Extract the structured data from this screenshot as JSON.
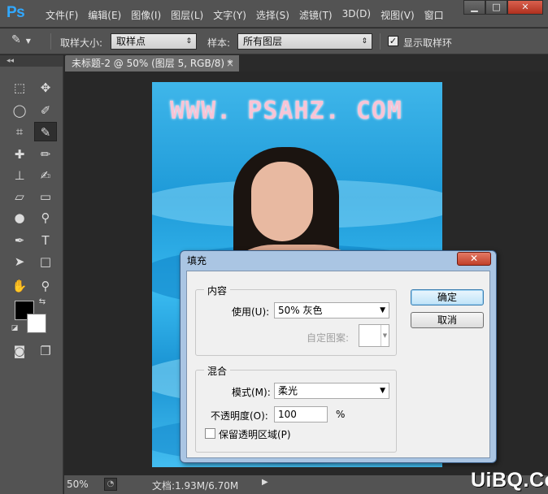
{
  "app": {
    "logo": "Ps",
    "menu": [
      "文件(F)",
      "编辑(E)",
      "图像(I)",
      "图层(L)",
      "文字(Y)",
      "选择(S)",
      "滤镜(T)",
      "3D(D)",
      "视图(V)",
      "窗口"
    ],
    "window_controls": {
      "minimize": "▁",
      "maximize": "□",
      "close": "✕"
    }
  },
  "options_bar": {
    "sample_size_label": "取样大小:",
    "sample_size_value": "取样点",
    "sample_label": "样本:",
    "sample_value": "所有图层",
    "show_ring_label": "显示取样环",
    "show_ring_checked": true
  },
  "document": {
    "tab_title": "未标题-2 @ 50% (图层 5, RGB/8) *",
    "tab_close": "×",
    "canvas_watermark": "WWW. PSAHZ. COM"
  },
  "status_bar": {
    "zoom": "50%",
    "doc_info": "文档:1.93M/6.70M",
    "site_mark": "UiBQ.CoM"
  },
  "fill_dialog": {
    "title": "填充",
    "close": "✕",
    "contents_group": "内容",
    "use_label": "使用(U):",
    "use_value": "50% 灰色",
    "custom_pattern_label": "自定图案:",
    "blending_group": "混合",
    "mode_label": "模式(M):",
    "mode_value": "柔光",
    "opacity_label": "不透明度(O):",
    "opacity_value": "100",
    "opacity_unit": "%",
    "preserve_transparency_label": "保留透明区域(P)",
    "preserve_transparency_checked": false,
    "ok_button": "确定",
    "cancel_button": "取消"
  },
  "colors": {
    "foreground": "#000000",
    "background": "#ffffff",
    "ps_blue": "#31a8ff"
  }
}
